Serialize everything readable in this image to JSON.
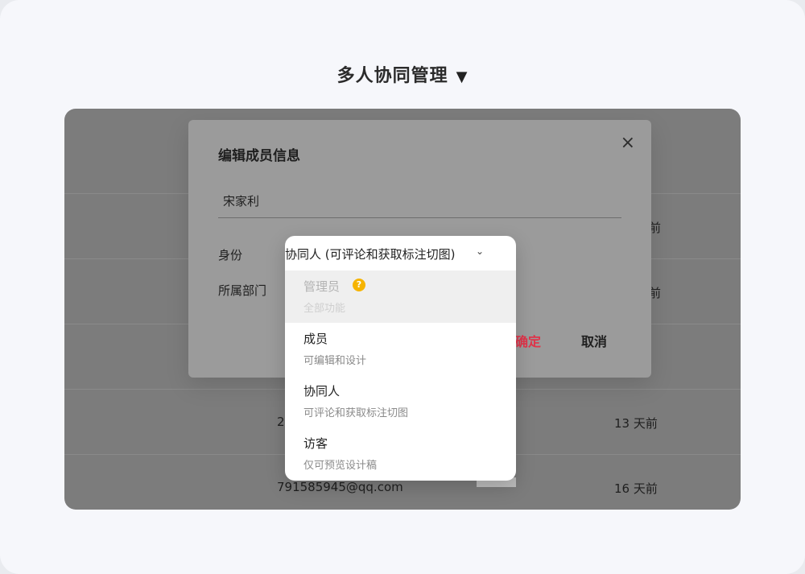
{
  "page_title": "多人协同管理",
  "title_triangle": "▼",
  "background_rows": [
    {
      "right": "前"
    },
    {
      "right": "前"
    },
    {
      "left": "2",
      "right": "13 天前"
    },
    {
      "left": "791585945@qq.com",
      "right": "16 天前"
    }
  ],
  "modal": {
    "title": "编辑成员信息",
    "close_icon": "×",
    "name_value": "宋家利",
    "role_label": "身份",
    "dept_label": "所属部门",
    "confirm_label": "确定",
    "cancel_label": "取消"
  },
  "dropdown": {
    "selected": "协同人 (可评论和获取标注切图)",
    "chevron": "⌄",
    "options": [
      {
        "title": "管理员",
        "desc": "全部功能",
        "disabled": true,
        "help_icon": "?"
      },
      {
        "title": "成员",
        "desc": "可编辑和设计",
        "disabled": false
      },
      {
        "title": "协同人",
        "desc": "可评论和获取标注切图",
        "disabled": false
      },
      {
        "title": "访客",
        "desc": "仅可预览设计稿",
        "disabled": false
      }
    ]
  },
  "colors": {
    "confirm": "#e0344a",
    "help": "#f6b400",
    "overlay": "#7c7c7c"
  }
}
